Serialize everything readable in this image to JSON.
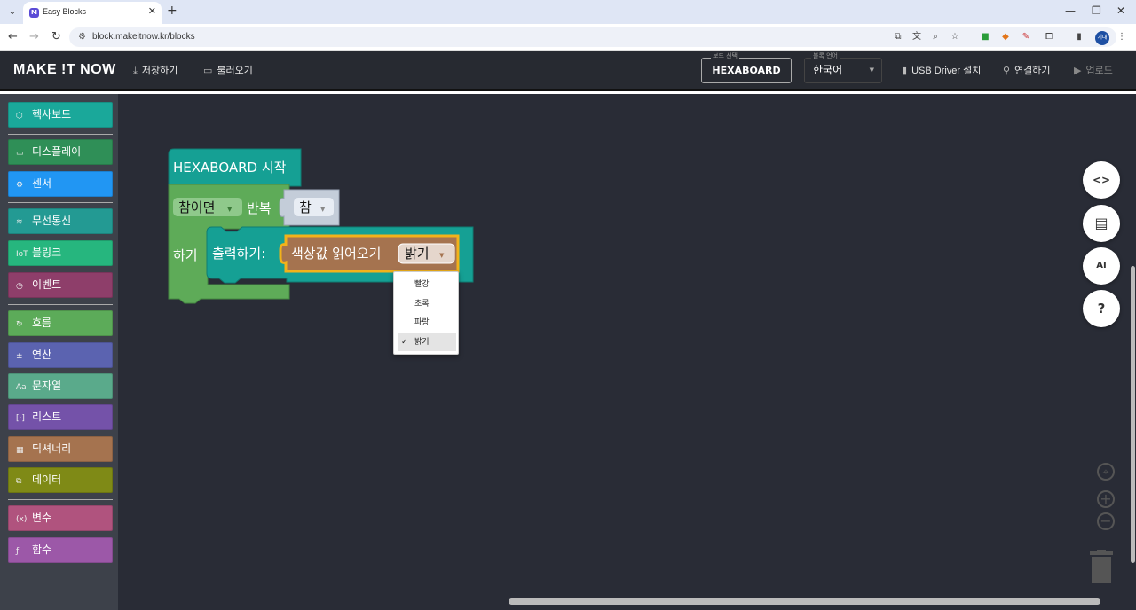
{
  "browser": {
    "tab_title": "Easy Blocks",
    "favicon_letter": "M",
    "url": "block.makeitnow.kr/blocks",
    "profile_label": "기대"
  },
  "header": {
    "logo": "MAKE !T NOW",
    "save": "저장하기",
    "load": "불러오기",
    "board_label": "보드 선택",
    "board_value": "HEXABOARD",
    "lang_label": "블록 언어",
    "lang_value": "한국어",
    "usb": "USB Driver 설치",
    "connect": "연결하기",
    "upload": "업로드"
  },
  "sidebar": {
    "categories": [
      {
        "label": "헥사보드",
        "color": "#1aa89a",
        "icon": "hexaboard-icon"
      },
      {
        "label": "디스플레이",
        "color": "#2f8f57",
        "icon": "display-icon"
      },
      {
        "label": "센서",
        "color": "#2196f3",
        "icon": "sensor-icon"
      },
      {
        "label": "무선통신",
        "color": "#239a93",
        "icon": "wifi-icon"
      },
      {
        "label": "블링크",
        "color": "#26b67e",
        "icon": "iot-icon"
      },
      {
        "label": "이벤트",
        "color": "#8e3e6a",
        "icon": "clock-icon"
      },
      {
        "label": "흐름",
        "color": "#5cab59",
        "icon": "loop-icon"
      },
      {
        "label": "연산",
        "color": "#5b63b0",
        "icon": "math-icon"
      },
      {
        "label": "문자열",
        "color": "#5aaa8b",
        "icon": "text-icon"
      },
      {
        "label": "리스트",
        "color": "#7452a9",
        "icon": "list-icon"
      },
      {
        "label": "딕셔너리",
        "color": "#a5734f",
        "icon": "dictionary-icon"
      },
      {
        "label": "데이터",
        "color": "#7f8a16",
        "icon": "data-icon"
      },
      {
        "label": "변수",
        "color": "#b0537e",
        "icon": "variable-icon"
      },
      {
        "label": "함수",
        "color": "#9c58a8",
        "icon": "function-icon"
      }
    ]
  },
  "blocks": {
    "start": "HEXABOARD 시작",
    "loop_mode": "참이면",
    "loop_word": "반복",
    "loop_cond": "참",
    "do_word": "하기",
    "print": "출력하기:",
    "read_color": "색상값 읽어오기",
    "color_field": "밝기"
  },
  "dropdown": {
    "options": [
      "빨강",
      "초록",
      "파랑",
      "밝기"
    ],
    "selected_index": 3
  },
  "controls": {
    "code": "<>",
    "ai": "AI",
    "help": "?"
  }
}
